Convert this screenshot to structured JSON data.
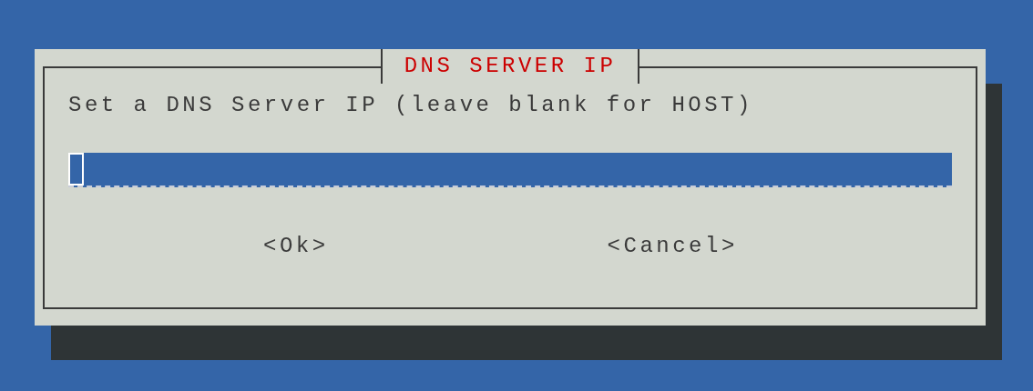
{
  "dialog": {
    "title": "DNS SERVER IP",
    "prompt": "Set a DNS Server IP (leave blank for HOST)",
    "field": {
      "focused": true
    },
    "buttons": [
      {
        "label": "<Ok>"
      },
      {
        "label": "<Cancel>"
      }
    ]
  }
}
